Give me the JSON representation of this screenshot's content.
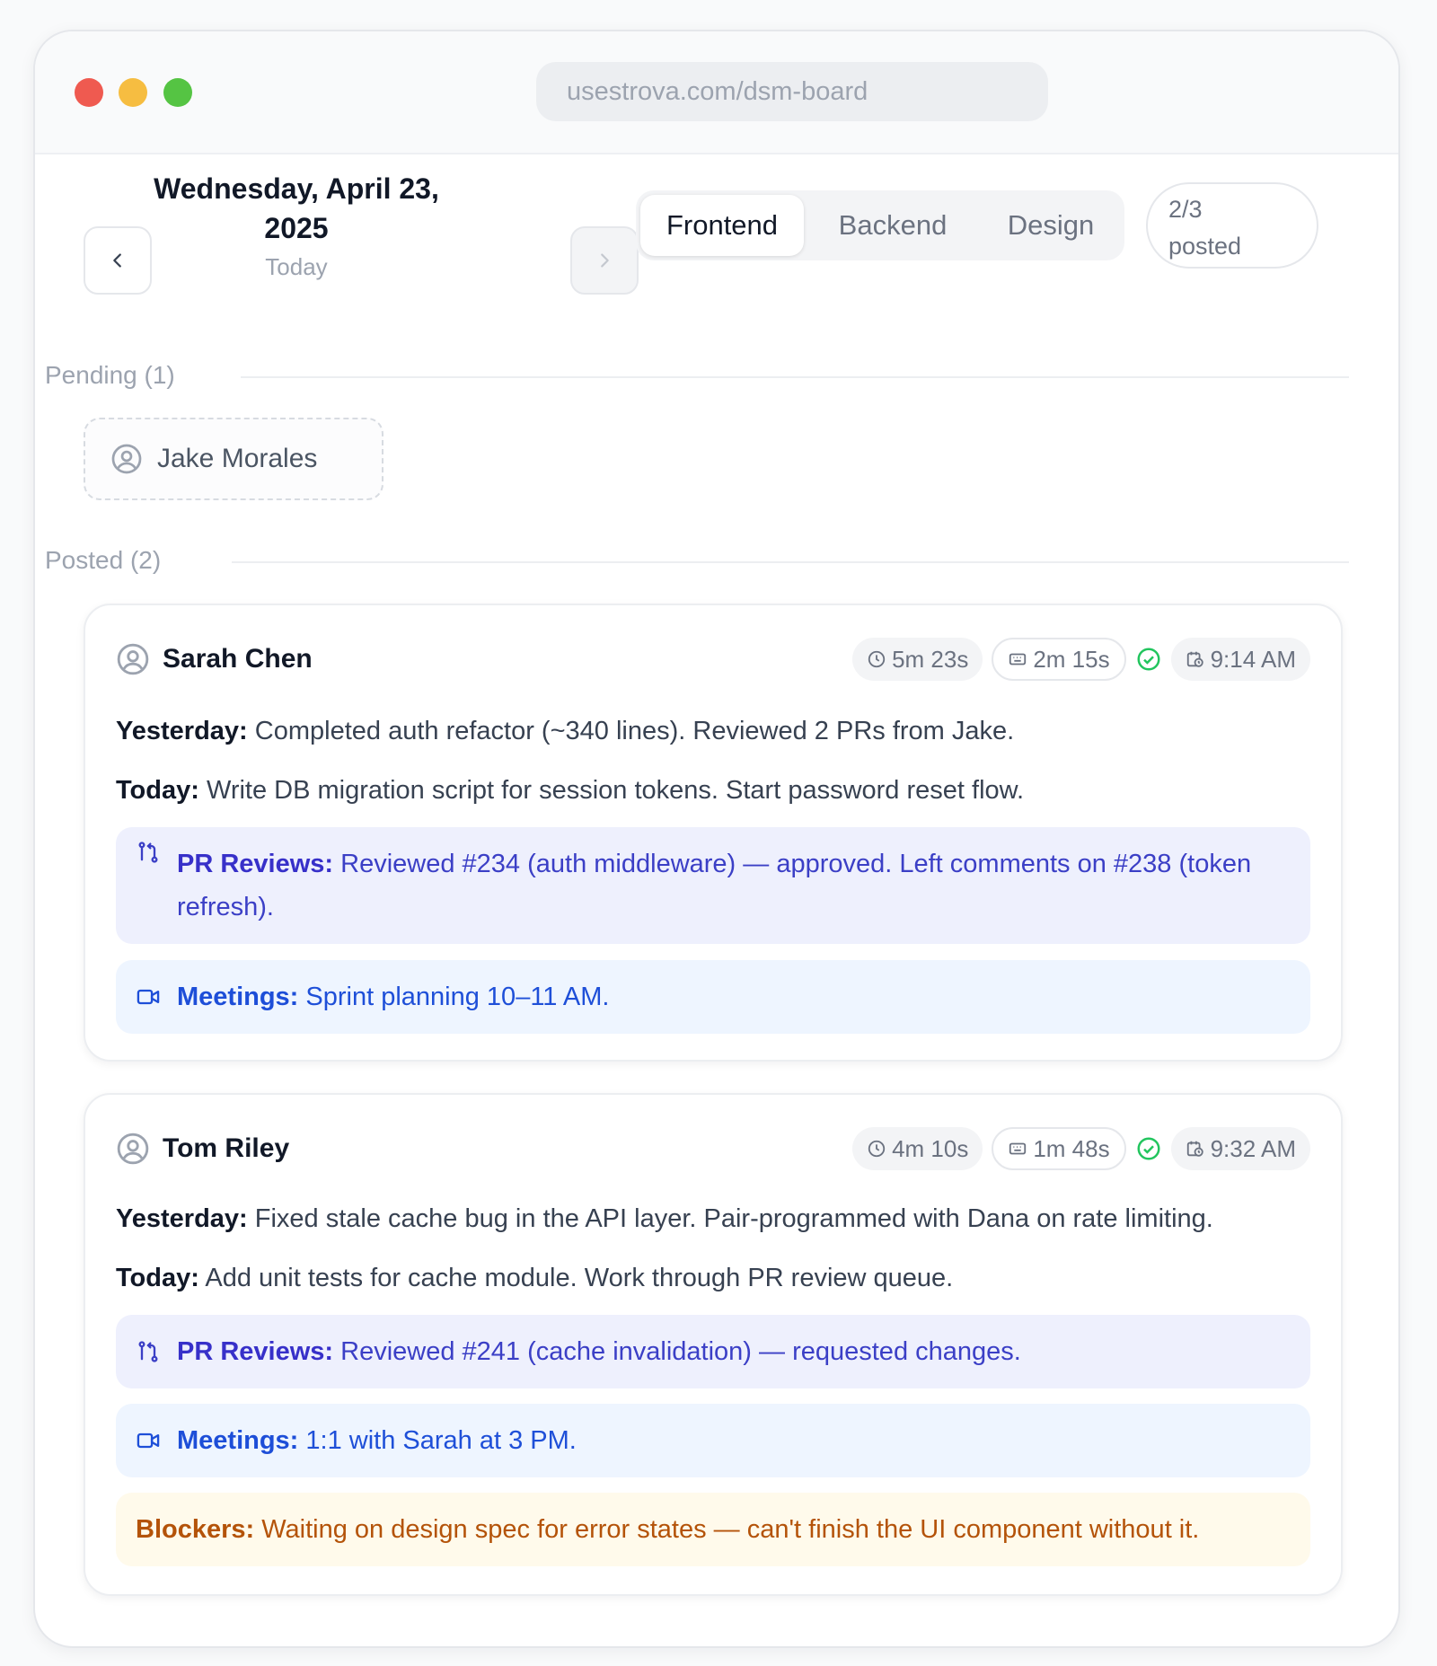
{
  "browser": {
    "url": "usestrova.com/dsm-board"
  },
  "header": {
    "date": "Wednesday, April 23, 2025",
    "date_sub": "Today",
    "tabs": [
      {
        "label": "Frontend",
        "active": true
      },
      {
        "label": "Backend",
        "active": false
      },
      {
        "label": "Design",
        "active": false
      }
    ],
    "posted_count": "2/3",
    "posted_word": "posted"
  },
  "pending": {
    "label": "Pending (1)",
    "people": [
      {
        "name": "Jake Morales"
      }
    ]
  },
  "posted": {
    "label": "Posted (2)",
    "entries": [
      {
        "name": "Sarah Chen",
        "duration": "5m 23s",
        "typing_time": "2m 15s",
        "time": "9:14 AM",
        "yesterday_label": "Yesterday:",
        "yesterday": "Completed auth refactor (~340 lines). Reviewed 2 PRs from Jake.",
        "today_label": "Today:",
        "today": "Write DB migration script for session tokens. Start password reset flow.",
        "pr_label": "PR Reviews:",
        "pr": "Reviewed #234 (auth middleware) — approved. Left comments on #238 (token refresh).",
        "meetings_label": "Meetings:",
        "meetings": "Sprint planning 10–11 AM."
      },
      {
        "name": "Tom Riley",
        "duration": "4m 10s",
        "typing_time": "1m 48s",
        "time": "9:32 AM",
        "yesterday_label": "Yesterday:",
        "yesterday": "Fixed stale cache bug in the API layer. Pair-programmed with Dana on rate limiting.",
        "today_label": "Today:",
        "today": "Add unit tests for cache module. Work through PR review queue.",
        "pr_label": "PR Reviews:",
        "pr": "Reviewed #241 (cache invalidation) — requested changes.",
        "meetings_label": "Meetings:",
        "meetings": "1:1 with Sarah at 3 PM.",
        "blockers_label": "Blockers:",
        "blockers": "Waiting on design spec for error states — can't finish the UI component without it."
      }
    ]
  },
  "icons": {
    "prev": "chevron-left-icon",
    "next": "chevron-right-icon",
    "user": "user-circle-icon",
    "clock": "clock-icon",
    "keyboard": "keyboard-icon",
    "check": "check-circle-icon",
    "calendar": "calendar-clock-icon",
    "pr": "git-pull-request-icon",
    "video": "video-icon"
  },
  "colors": {
    "pr_text": "#3b3fc6",
    "meetings_text": "#1e4fd8",
    "blockers_text": "#b45309",
    "check_green": "#22c55e"
  }
}
